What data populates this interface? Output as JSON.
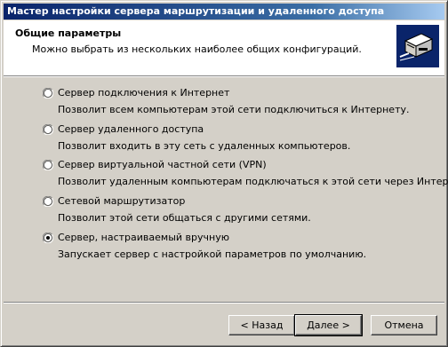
{
  "window": {
    "title": "Мастер настройки сервера маршрутизации и удаленного доступа"
  },
  "header": {
    "title": "Общие параметры",
    "subtitle": "Можно выбрать из нескольких наиболее общих конфигураций.",
    "icon": "server-network-icon"
  },
  "options": [
    {
      "label": "Сервер подключения к Интернет",
      "desc": "Позволит всем компьютерам этой сети подключиться к Интернету.",
      "selected": false
    },
    {
      "label": "Сервер удаленного доступа",
      "desc": "Позволит входить в эту сеть с удаленных компьютеров.",
      "selected": false
    },
    {
      "label": "Сервер виртуальной частной сети (VPN)",
      "desc": "Позволит удаленным компьютерам подключаться к этой сети через Интернет.",
      "selected": false
    },
    {
      "label": "Сетевой маршрутизатор",
      "desc": "Позволит этой сети общаться с другими сетями.",
      "selected": false
    },
    {
      "label": "Сервер, настраиваемый вручную",
      "desc": "Запускает сервер с настройкой параметров по умолчанию.",
      "selected": true
    }
  ],
  "buttons": {
    "back": "< Назад",
    "next": "Далее >",
    "cancel": "Отмена"
  }
}
